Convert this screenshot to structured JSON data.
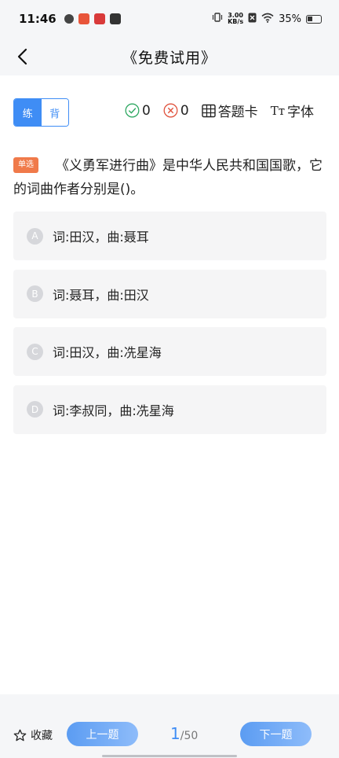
{
  "status_bar": {
    "time": "11:46",
    "net_speed_value": "3.00",
    "net_speed_unit": "KB/s",
    "battery": "35%"
  },
  "nav": {
    "title": "《免费试用》"
  },
  "toolbar": {
    "mode_practice": "练",
    "mode_recite": "背",
    "correct_count": "0",
    "wrong_count": "0",
    "answer_card_label": "答题卡",
    "font_label": "字体",
    "font_icon_text": "Tт"
  },
  "question": {
    "type_badge": "单选",
    "text": "《义勇军进行曲》是中华人民共和国国歌，它的词曲作者分别是()。"
  },
  "options": [
    {
      "letter": "A",
      "text": "词:田汉，曲:聂耳"
    },
    {
      "letter": "B",
      "text": "词:聂耳，曲:田汉"
    },
    {
      "letter": "C",
      "text": "词:田汉，曲:冼星海"
    },
    {
      "letter": "D",
      "text": "词:李叔同，曲:冼星海"
    }
  ],
  "bottom": {
    "favorite_label": "收藏",
    "prev_label": "上一题",
    "next_label": "下一题",
    "current_page": "1",
    "total_pages": "/50"
  },
  "colors": {
    "accent": "#3f8df5",
    "badge": "#f07a4a",
    "correct": "#2fa862",
    "wrong": "#e0523d"
  }
}
